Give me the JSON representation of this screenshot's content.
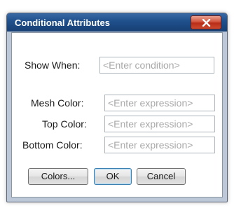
{
  "dialog": {
    "title": "Conditional Attributes"
  },
  "fields": {
    "show_when": {
      "label": "Show When:",
      "placeholder": "<Enter condition>"
    },
    "mesh_color": {
      "label": "Mesh Color:",
      "placeholder": "<Enter expression>"
    },
    "top_color": {
      "label": "Top Color:",
      "placeholder": "<Enter expression>"
    },
    "bottom_color": {
      "label": "Bottom Color:",
      "placeholder": "<Enter expression>"
    }
  },
  "buttons": {
    "colors": "Colors...",
    "ok": "OK",
    "cancel": "Cancel"
  },
  "icons": {
    "close": "close-icon"
  },
  "colors": {
    "title_bar": "#1f4f8b",
    "close_button": "#c9432a",
    "frame": "#bcc8d7"
  }
}
